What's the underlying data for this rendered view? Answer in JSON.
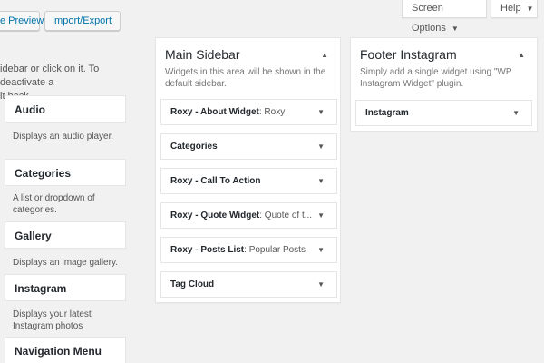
{
  "toolbar": {
    "preview_label": "e Preview",
    "import_label": "Import/Export",
    "screen_options_label": "Screen Options",
    "help_label": "Help",
    "caret": "▼"
  },
  "available": {
    "description": "idebar or click on it. To deactivate a\nit back.",
    "widgets": [
      {
        "title": "Audio",
        "desc": "Displays an audio player."
      },
      {
        "title": "Categories",
        "desc": "A list or dropdown of categories."
      },
      {
        "title": "Gallery",
        "desc": "Displays an image gallery."
      },
      {
        "title": "Instagram",
        "desc": "Displays your latest Instagram photos"
      },
      {
        "title": "Navigation Menu",
        "desc": ""
      }
    ]
  },
  "main_sidebar": {
    "title": "Main Sidebar",
    "toggle": "▲",
    "description": "Widgets in this area will be shown in the default sidebar.",
    "widgets": [
      {
        "name": "Roxy - About Widget",
        "sub": ": Roxy"
      },
      {
        "name": "Categories",
        "sub": ""
      },
      {
        "name": "Roxy - Call To Action",
        "sub": ""
      },
      {
        "name": "Roxy - Quote Widget",
        "sub": ": Quote of t..."
      },
      {
        "name": "Roxy - Posts List",
        "sub": ": Popular Posts"
      },
      {
        "name": "Tag Cloud",
        "sub": ""
      }
    ],
    "arrow": "▼"
  },
  "footer_instagram": {
    "title": "Footer Instagram",
    "toggle": "▲",
    "description": "Simply add a single widget using \"WP Instagram Widget\" plugin.",
    "widgets": [
      {
        "name": "Instagram",
        "sub": ""
      }
    ],
    "arrow": "▼"
  }
}
